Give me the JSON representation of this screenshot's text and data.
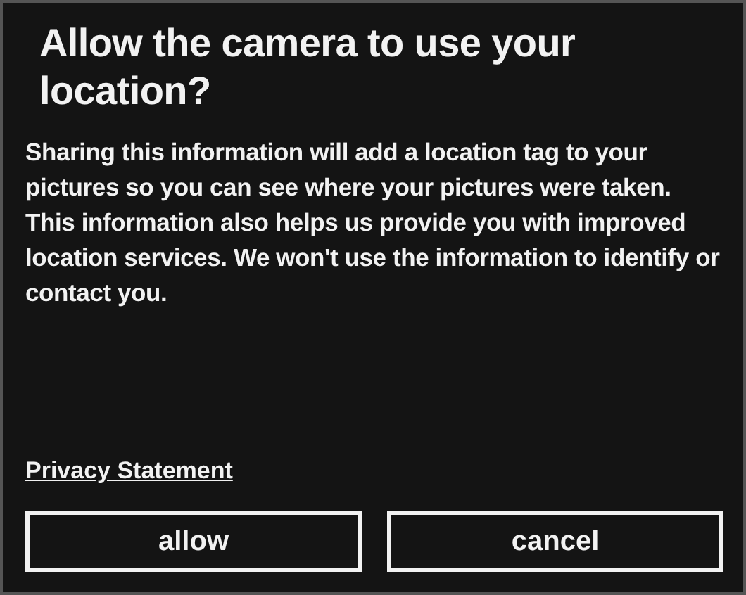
{
  "dialog": {
    "title": "Allow the camera to use your location?",
    "message": "Sharing this information will add a location tag to your pictures so you can see where your pictures were taken. This information also helps us provide you with improved location services. We won't use the information to identify or contact you.",
    "link": "Privacy Statement",
    "buttons": [
      "allow",
      "cancel"
    ]
  }
}
